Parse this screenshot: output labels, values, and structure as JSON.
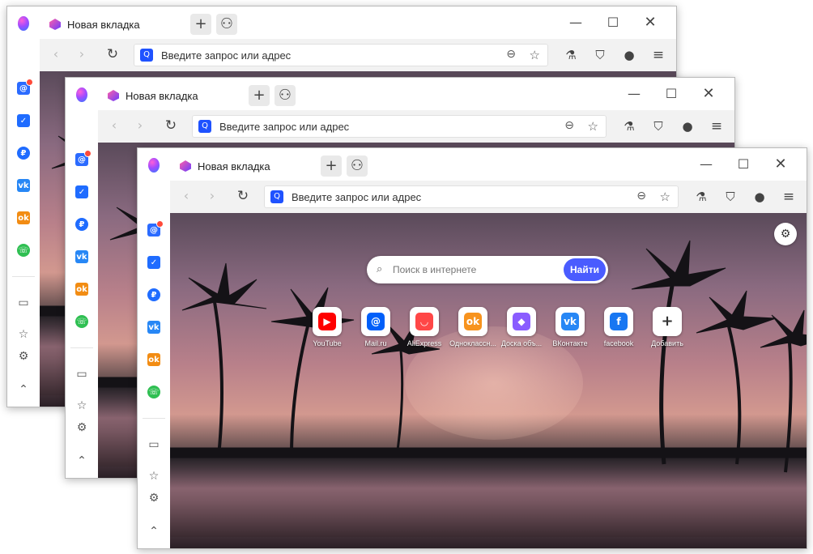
{
  "tab": {
    "title": "Новая вкладка"
  },
  "address": {
    "placeholder": "Введите запрос или адрес"
  },
  "search": {
    "placeholder": "Поиск в интернете",
    "button": "Найти"
  },
  "tiles": [
    {
      "label": "YouTube",
      "icon": "youtube-icon",
      "color": "#ff0000"
    },
    {
      "label": "Mail.ru",
      "icon": "mailru-icon",
      "color": "#005ff9"
    },
    {
      "label": "AliExpress",
      "icon": "aliexpress-icon",
      "color": "#ff4747"
    },
    {
      "label": "Одноклассн...",
      "icon": "odnoklassniki-icon",
      "color": "#f7931e"
    },
    {
      "label": "Доска объ...",
      "icon": "board-icon",
      "color": "#8a5cff"
    },
    {
      "label": "ВКонтакте",
      "icon": "vk-icon",
      "color": "#2787f5"
    },
    {
      "label": "facebook",
      "icon": "facebook-icon",
      "color": "#1877f2"
    },
    {
      "label": "Добавить",
      "icon": "plus-icon",
      "color": "#333333"
    }
  ],
  "sidebar_icons": [
    "mail-icon",
    "tasks-icon",
    "pay-icon",
    "vk-icon",
    "ok-icon",
    "whatsapp-icon",
    "book-icon",
    "star-icon",
    "settings-icon",
    "chevron-up-icon"
  ],
  "colors": {
    "accent": "#3a62ff",
    "search_button": "#4a5cff"
  }
}
